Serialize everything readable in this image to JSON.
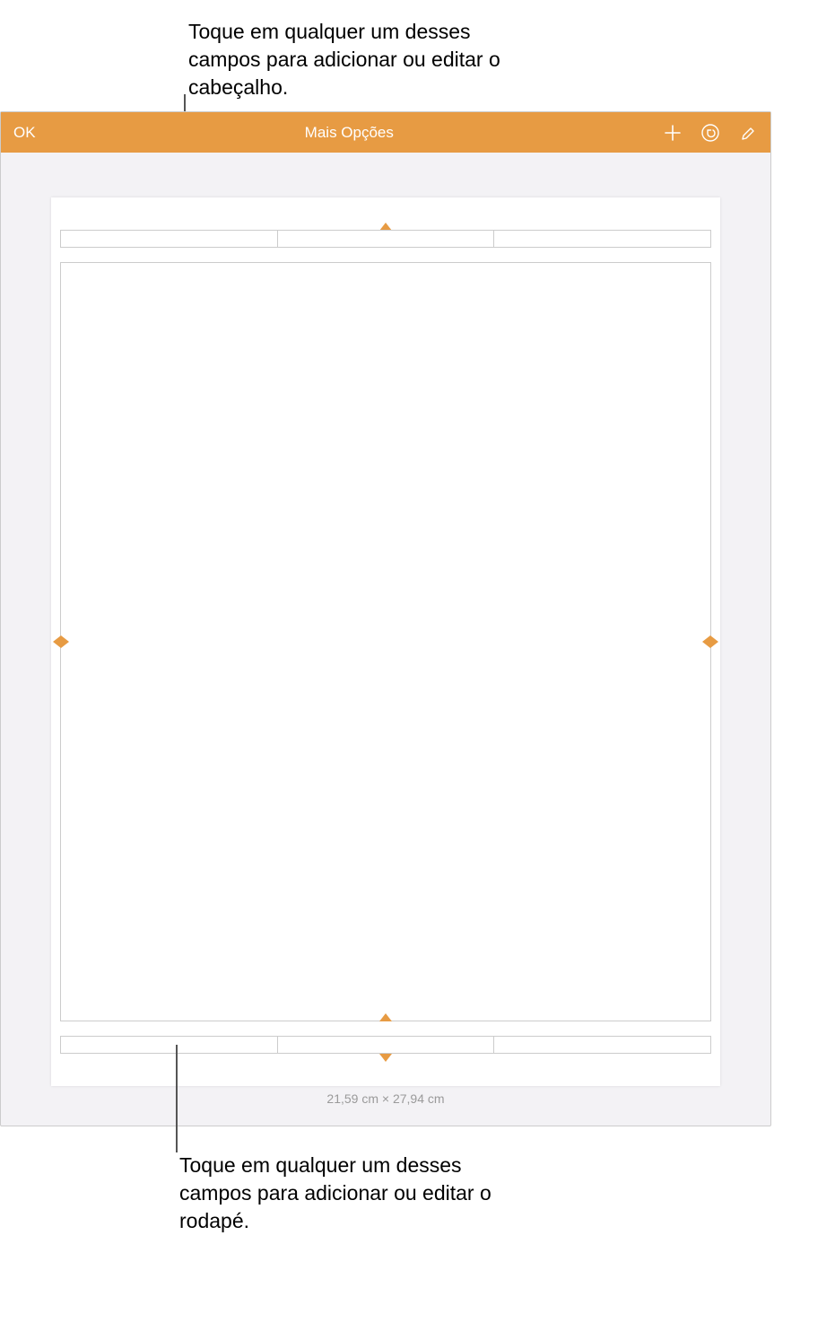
{
  "callouts": {
    "top": "Toque em qualquer um desses campos para adicionar ou editar o cabeçalho.",
    "bottom": "Toque em qualquer um desses campos para adicionar ou editar o rodapé."
  },
  "toolbar": {
    "ok_label": "OK",
    "title": "Mais Opções"
  },
  "page": {
    "dimensions": "21,59 cm × 27,94 cm"
  },
  "colors": {
    "accent": "#e79b43"
  }
}
